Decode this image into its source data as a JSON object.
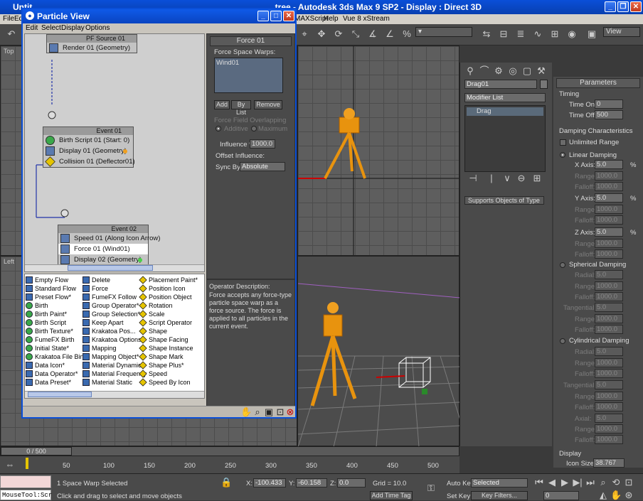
{
  "main_window": {
    "title_left": "Untit",
    "title_right": "_tree - Autodesk 3ds Max 9 SP2 - Display : Direct 3D"
  },
  "main_menu": {
    "file": "File",
    "edit": "Ed",
    "maxscript": "MAXScript",
    "help": "Help",
    "vue": "Vue 8 xStream"
  },
  "toolbar": {
    "view_dropdown": "View"
  },
  "viewports": {
    "top_label": "Top",
    "left_label": "Left"
  },
  "particle_view": {
    "title": "Particle View",
    "menu": {
      "edit": "Edit",
      "select": "Select",
      "display": "Display",
      "options": "Options"
    },
    "nodes": {
      "pf_source": {
        "title": "PF Source 01",
        "rows": [
          "Render 01 (Geometry)"
        ]
      },
      "event01": {
        "title": "Event 01",
        "rows": [
          "Birth Script 01 (Start: 0)",
          "Display 01 (Geometry)",
          "Collision 01 (Deflector01)"
        ]
      },
      "event02": {
        "title": "Event 02",
        "rows": [
          "Speed 01 (Along Icon Arrow)",
          "Force 01 (Wind01)",
          "Display 02 (Geometry)"
        ]
      }
    },
    "force_panel": {
      "header": "Force 01",
      "space_warps_label": "Force Space Warps:",
      "warp_item": "Wind01",
      "add": "Add",
      "by_list": "By List",
      "remove": "Remove",
      "overlap_label": "Force Field Overlapping",
      "additive": "Additive",
      "maximum": "Maximum",
      "influence_label": "Influence %",
      "influence_value": "1000.0",
      "offset_label": "Offset Influence:",
      "sync_label": "Sync By:",
      "sync_value": "Absolute"
    },
    "description": {
      "label": "Operator Description:",
      "text": "Force accepts any force-type particle space warp as a force source. The force is applied to all particles in the current event."
    },
    "depot": {
      "col1": [
        "Empty Flow",
        "Standard Flow",
        "Preset Flow*",
        "Birth",
        "Birth Paint*",
        "Birth Script",
        "Birth Texture*",
        "FumeFX Birth",
        "Initial State*",
        "Krakatoa File Birth",
        "Data Icon*",
        "Data Operator*",
        "Data Preset*"
      ],
      "col2": [
        "Delete",
        "Force",
        "FumeFX Follow",
        "Group Operator*",
        "Group Selection*",
        "Keep Apart",
        "Krakatoa Pos...",
        "Krakatoa Options",
        "Mapping",
        "Mapping Object*",
        "Material Dynamic",
        "Material Frequency",
        "Material Static"
      ],
      "col3": [
        "Placement Paint*",
        "Position Icon",
        "Position Object",
        "Rotation",
        "Scale",
        "Script Operator",
        "Shape",
        "Shape Facing",
        "Shape Instance",
        "Shape Mark",
        "Shape Plus*",
        "Speed",
        "Speed By Icon"
      ]
    }
  },
  "command_panel": {
    "object_name": "Drag01",
    "modifier_list": "Modifier List",
    "stack_item": "Drag",
    "supports_btn": "Supports Objects of Type"
  },
  "parameters": {
    "header": "Parameters",
    "timing": "Timing",
    "time_on_label": "Time On:",
    "time_on": "0",
    "time_off_label": "Time Off:",
    "time_off": "500",
    "damping_characteristics": "Damping Characteristics",
    "unlimited_range": "Unlimited Range",
    "linear_damping": "Linear Damping",
    "x_axis": "X Axis:",
    "y_axis": "Y Axis:",
    "z_axis": "Z Axis:",
    "axis_value": "5.0",
    "range": "Range:",
    "falloff": "Falloff:",
    "range_value": "1000.0",
    "falloff_value": "1000.0",
    "spherical_damping": "Spherical Damping",
    "radial": "Radial:",
    "tangential": "Tangential:",
    "cylindrical_damping": "Cylindrical Damping",
    "axial": "Axial:",
    "display": "Display",
    "icon_size_label": "Icon Size:",
    "icon_size": "38.767",
    "percent": "%"
  },
  "timeline": {
    "frame": "0 / 500",
    "ticks": [
      "50",
      "100",
      "150",
      "200",
      "250",
      "300",
      "350",
      "400",
      "450",
      "500"
    ]
  },
  "status": {
    "mousetool": "MouseTool:Scr",
    "selected_msg": "1 Space Warp Selected",
    "prompt": "Click and drag to select and move objects",
    "x_label": "X:",
    "x": "-100.433",
    "y_label": "Y:",
    "y": "-60.158",
    "z_label": "Z:",
    "z": "0.0",
    "grid": "Grid = 10.0",
    "add_time_tag": "Add Time Tag",
    "auto_key": "Auto Key",
    "auto_key_value": "Selected",
    "set_key": "Set Key",
    "key_filters": "Key Filters...",
    "frame_value": "0"
  }
}
